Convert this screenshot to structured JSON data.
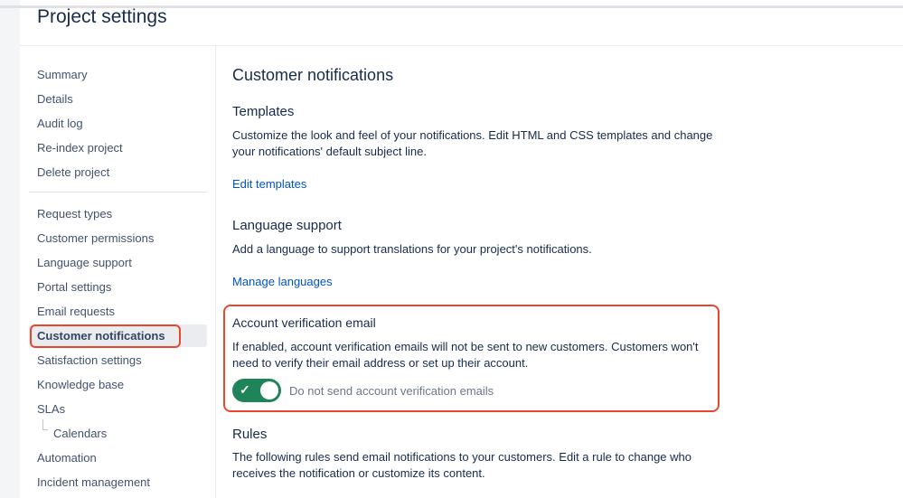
{
  "header": {
    "title": "Project settings"
  },
  "sidebar": {
    "group1": [
      "Summary",
      "Details",
      "Audit log",
      "Re-index project",
      "Delete project"
    ],
    "group2": [
      "Request types",
      "Customer permissions",
      "Language support",
      "Portal settings",
      "Email requests",
      "Customer notifications",
      "Satisfaction settings",
      "Knowledge base",
      "SLAs",
      "Calendars",
      "Automation",
      "Incident management"
    ],
    "selected": "Customer notifications"
  },
  "main": {
    "title": "Customer notifications",
    "templates": {
      "heading": "Templates",
      "text": "Customize the look and feel of your notifications. Edit HTML and CSS templates and change your notifications' default subject line.",
      "link": "Edit templates"
    },
    "language": {
      "heading": "Language support",
      "text": "Add a language to support translations for your project's notifications.",
      "link": "Manage languages"
    },
    "verification": {
      "heading": "Account verification email",
      "text": "If enabled, account verification emails will not be sent to new customers. Customers won't need to verify their email address or set up their account.",
      "toggle_label": "Do not send account verification emails",
      "toggle_on": true,
      "check": "✓"
    },
    "rules": {
      "heading": "Rules",
      "text": "The following rules send email notifications to your customers. Edit a rule to change who receives the notification or customize its content."
    }
  },
  "colors": {
    "accent": "#0052cc",
    "toggle": "#1f845a",
    "highlight": "#e8472e"
  }
}
